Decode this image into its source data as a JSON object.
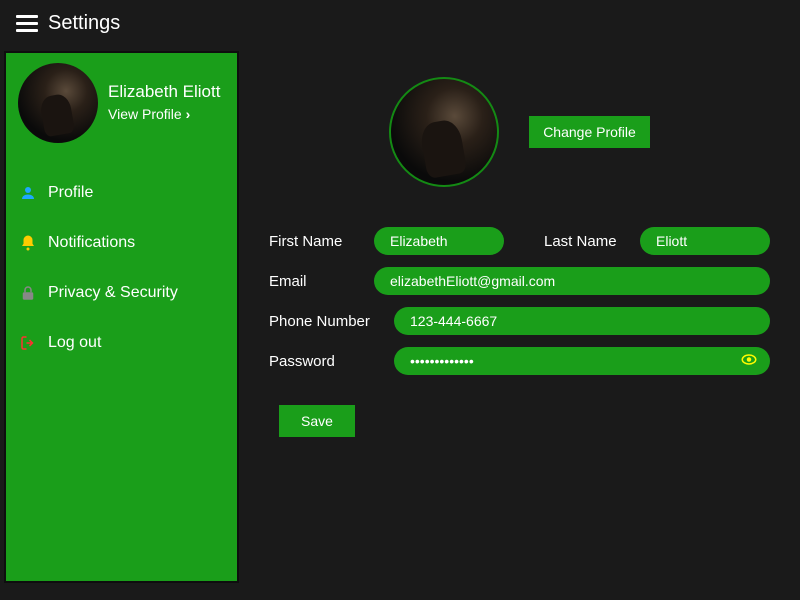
{
  "header": {
    "title": "Settings"
  },
  "sidebar": {
    "profile_name": "Elizabeth Eliott",
    "view_profile_label": "View Profile",
    "items": [
      {
        "label": "Profile",
        "icon": "user-icon"
      },
      {
        "label": "Notifications",
        "icon": "bell-icon"
      },
      {
        "label": "Privacy & Security",
        "icon": "lock-icon"
      },
      {
        "label": "Log out",
        "icon": "logout-icon"
      }
    ]
  },
  "main": {
    "change_profile_label": "Change Profile",
    "fields": {
      "first_name_label": "First Name",
      "first_name_value": "Elizabeth",
      "last_name_label": "Last Name",
      "last_name_value": "Eliott",
      "email_label": "Email",
      "email_value": "elizabethEliott@gmail.com",
      "phone_label": "Phone Number",
      "phone_value": "123-444-6667",
      "password_label": "Password",
      "password_value": "•••••••••••••"
    },
    "save_label": "Save"
  },
  "colors": {
    "accent": "#1a9e1a",
    "bg": "#1a1a1a"
  }
}
